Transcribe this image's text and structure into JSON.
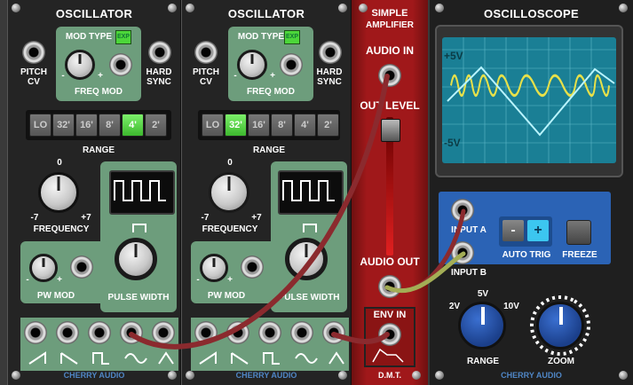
{
  "oscillator1": {
    "title": "OSCILLATOR",
    "mod_type": "MOD TYPE",
    "exp": "EXP",
    "pitch_cv": "PITCH\nCV",
    "hard_sync": "HARD\nSYNC",
    "freq_mod": "FREQ MOD",
    "range_buttons": [
      "LO",
      "32'",
      "16'",
      "8'",
      "4'",
      "2'"
    ],
    "range_active": 4,
    "range": "RANGE",
    "freq_zero": "0",
    "freq_min": "-7",
    "freq_max": "+7",
    "frequency": "FREQUENCY",
    "pw_mod": "PW MOD",
    "pulse_width": "PULSE WIDTH",
    "minus": "-",
    "plus": "+",
    "brand": "CHERRY AUDIO"
  },
  "oscillator2": {
    "title": "OSCILLATOR",
    "mod_type": "MOD TYPE",
    "exp": "EXP",
    "pitch_cv": "PITCH\nCV",
    "hard_sync": "HARD\nSYNC",
    "freq_mod": "FREQ MOD",
    "range_buttons": [
      "LO",
      "32'",
      "16'",
      "8'",
      "4'",
      "2'"
    ],
    "range_active": 1,
    "range": "RANGE",
    "freq_zero": "0",
    "freq_min": "-7",
    "freq_max": "+7",
    "frequency": "FREQUENCY",
    "pw_mod": "PW MOD",
    "pulse_width": "PULSE WIDTH",
    "minus": "-",
    "plus": "+",
    "brand": "CHERRY AUDIO"
  },
  "amplifier": {
    "title_1": "SIMPLE",
    "title_2": "AMPLIFIER",
    "audio_in": "AUDIO IN",
    "out_level": "OUT LEVEL",
    "audio_out": "AUDIO OUT",
    "env_in": "ENV IN",
    "brand": "D.M.T."
  },
  "oscilloscope": {
    "title": "OSCILLOSCOPE",
    "plus5v": "+5V",
    "minus5v": "-5V",
    "input_a": "INPUT A",
    "input_b": "INPUT B",
    "auto_trig": "AUTO TRIG",
    "freeze": "FREEZE",
    "minus_btn": "-",
    "plus_btn": "+",
    "range": "RANGE",
    "r2v": "2V",
    "r5v": "5V",
    "r10v": "10V",
    "zoom": "ZOOM",
    "brand": "CHERRY AUDIO",
    "screen_bg": "#1a7f95",
    "trace_a": "#e6e04a",
    "trace_b": "#b9f4ff"
  },
  "colors": {
    "panel_green": "#6d9d7c",
    "amp_red": "#a0181a",
    "cable_red": "#8b2a2e",
    "cable_green": "#a3ad55",
    "led_green": "#4cd63a",
    "trig_plus": "#3cc6f0"
  }
}
